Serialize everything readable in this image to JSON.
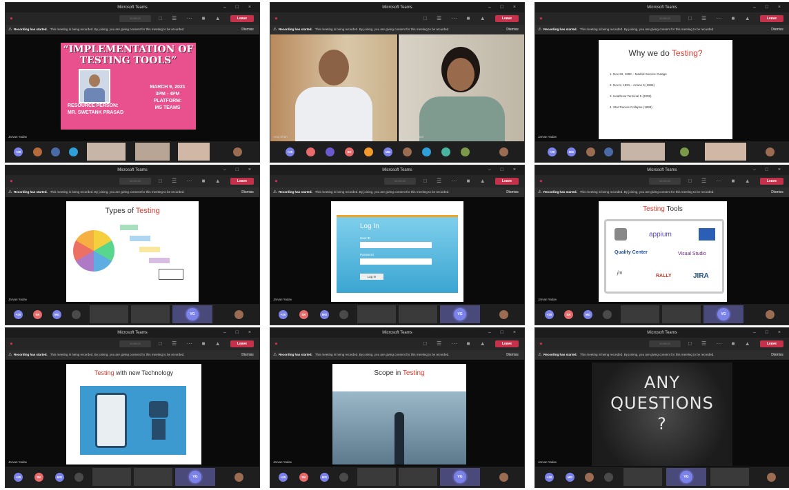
{
  "window_title": "Microsoft Teams",
  "toolbar": {
    "leave_label": "Leave",
    "time_placeholder": "00:00:00"
  },
  "recording": {
    "bold": "Recording has started.",
    "text": "This meeting is being recorded. By joining, you are giving consent for this meeting to be recorded.",
    "link": "Privacy policy",
    "dismiss": "Dismiss"
  },
  "panel1": {
    "title_line1": "“IMPLEMENTATION OF",
    "title_line2": "TESTING TOOLS”",
    "resource_label": "RESOURCE PERSON:",
    "resource_name": "MR. SWETANK PRASAD",
    "date": "MARCH 9, 2021",
    "time": "3PM - 4PM",
    "platform_label": "PLATFORM:",
    "platform_name": "MS TEAMS",
    "presenter": "Jarvan Yadav"
  },
  "panel2": {
    "names": [
      "Anuj Shah",
      "Ruchee Mahavir"
    ]
  },
  "panel3": {
    "title_a": "Why we do ",
    "title_b": "Testing?",
    "points": [
      "1. Nov 22, 1992 – Madrid Service Outage",
      "2. Nov 8, 1991 – Ariane 5 (1996)",
      "3. Heathrow Terminal 5 (2008)",
      "4. Star Racers Collapse (1998)"
    ]
  },
  "panel4": {
    "title_a": "Types of ",
    "title_b": "Testing"
  },
  "panel5": {
    "login": "Log In",
    "user_label": "User ID",
    "pass_label": "Password",
    "button": "Log In"
  },
  "panel6": {
    "title_a": "Testing",
    "title_b": " Tools",
    "logos": [
      "appium",
      "Quality Center",
      "Visual Studio",
      "RALLY",
      "JIRA"
    ]
  },
  "panel7": {
    "title_a": "Testing",
    "title_b": " with new Technology"
  },
  "panel8": {
    "title_a": "Scope in ",
    "title_b": "Testing"
  },
  "panel9": {
    "line1": "ANY",
    "line2": "QUESTIONS",
    "line3": "?"
  },
  "avatars": {
    "initials": [
      "SK",
      "MG",
      "VG"
    ],
    "count": "+20"
  },
  "colors": {
    "leave": "#c4314b",
    "accent_red": "#e03a2f",
    "teams_purple": "#7b83eb",
    "pink_slide": "#e8508e"
  }
}
